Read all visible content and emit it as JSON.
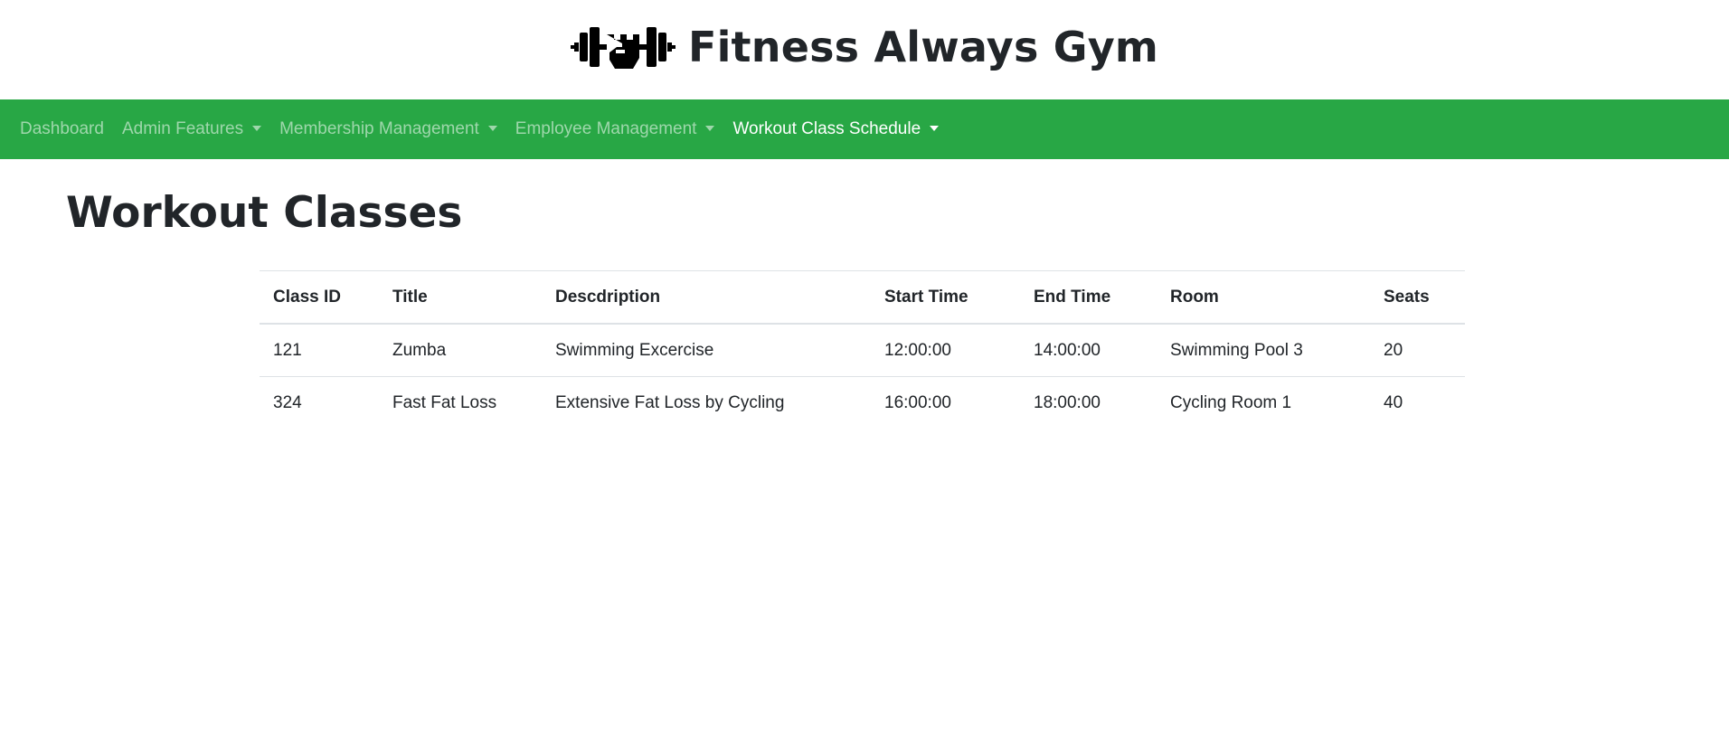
{
  "header": {
    "title": "Fitness Always Gym",
    "logo_icon": "dumbbell-fist-icon"
  },
  "nav": {
    "items": [
      {
        "label": "Dashboard",
        "dropdown": false
      },
      {
        "label": "Admin Features",
        "dropdown": true
      },
      {
        "label": "Membership Management",
        "dropdown": true
      },
      {
        "label": "Employee Management",
        "dropdown": true
      },
      {
        "label": "Workout Class Schedule",
        "dropdown": true,
        "active": true
      }
    ],
    "bg_color": "#28a745"
  },
  "main": {
    "title": "Workout Classes",
    "table": {
      "headers": [
        "Class ID",
        "Title",
        "Descdription",
        "Start Time",
        "End Time",
        "Room",
        "Seats"
      ],
      "rows": [
        [
          "121",
          "Zumba",
          "Swimming Excercise",
          "12:00:00",
          "14:00:00",
          "Swimming Pool 3",
          "20"
        ],
        [
          "324",
          "Fast Fat Loss",
          "Extensive Fat Loss by Cycling",
          "16:00:00",
          "18:00:00",
          "Cycling Room 1",
          "40"
        ]
      ]
    }
  }
}
